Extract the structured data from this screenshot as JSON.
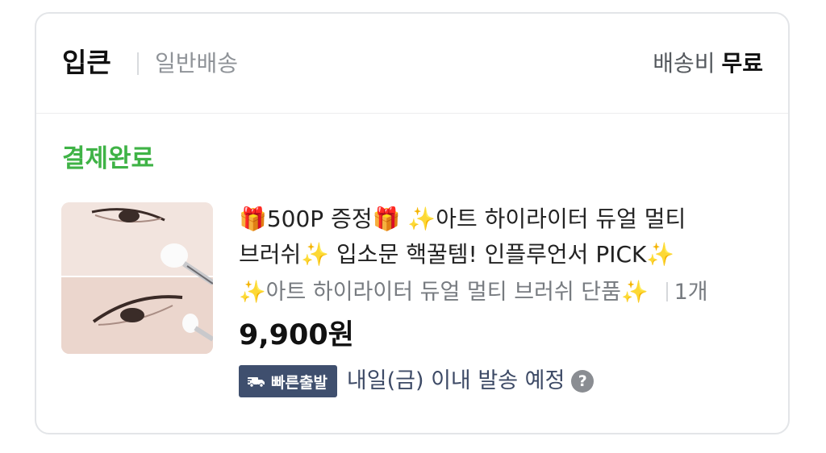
{
  "order": {
    "seller": "입큰",
    "shipping_type": "일반배송",
    "shipping_fee_label": "배송비",
    "shipping_fee_value": "무료"
  },
  "item": {
    "status": "결제완료",
    "title": "🎁500P 증정🎁 ✨아트 하이라이터 듀얼 멀티\n브러쉬✨ 입소문 핵꿀템! 인플루언서 PICK✨",
    "option": "✨아트 하이라이터 듀얼 멀티 브러쉬 단품✨",
    "quantity": "1개",
    "price": "9,900원",
    "delivery_badge": "빠른출발",
    "delivery_text": "내일(금) 이내 발송 예정",
    "help_symbol": "?"
  },
  "icons": {
    "thumbnail": "product-photo-eye-makeup-brush",
    "badge": "truck-icon",
    "help": "question-icon"
  },
  "colors": {
    "status_green": "#3fb346",
    "badge_bg": "#3f4f6e",
    "delivery_text": "#3d4a66"
  }
}
